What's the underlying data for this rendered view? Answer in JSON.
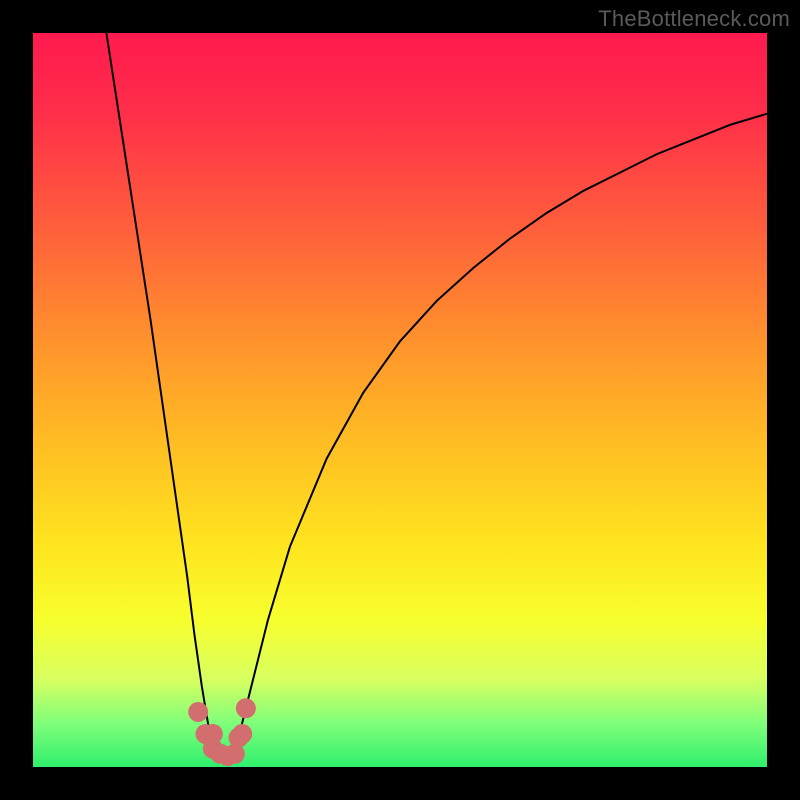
{
  "watermark": "TheBottleneck.com",
  "chart_data": {
    "type": "line",
    "title": "",
    "xlabel": "",
    "ylabel": "",
    "xlim": [
      0,
      100
    ],
    "ylim": [
      0,
      100
    ],
    "legend": false,
    "grid": false,
    "background": "gradient-green-to-red",
    "minimum_x": 26,
    "minimum_y": 1,
    "x": [
      10,
      12,
      14,
      16,
      18,
      20,
      21,
      22,
      23,
      24,
      25,
      26,
      27,
      28,
      29,
      30,
      32,
      35,
      40,
      45,
      50,
      55,
      60,
      65,
      70,
      75,
      80,
      85,
      90,
      95,
      100
    ],
    "values": [
      100,
      87,
      74,
      61,
      47,
      33,
      26,
      18,
      11,
      5,
      2,
      1,
      1.5,
      4,
      8,
      12,
      20,
      30,
      42,
      51,
      58,
      63.5,
      68,
      72,
      75.5,
      78.5,
      81,
      83.5,
      85.5,
      87.5,
      89
    ],
    "markers": {
      "x": [
        22.5,
        23.5,
        24.5,
        24.5,
        25.5,
        26.5,
        27.5,
        28,
        28.5,
        29
      ],
      "y": [
        7.5,
        4.5,
        2.5,
        4.5,
        1.8,
        1.5,
        1.8,
        4,
        4.5,
        8
      ],
      "color": "#d36e6e",
      "size": 10
    }
  }
}
